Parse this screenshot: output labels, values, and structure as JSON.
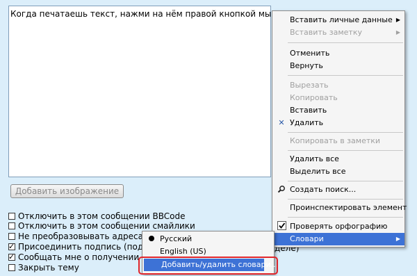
{
  "editor": {
    "text": "Когда печатаешь текст, нажми на нём правой кнопкой мыши."
  },
  "add_image_button": "Добавить изображение",
  "options": [
    {
      "label": "Отключить в этом сообщении BBCode",
      "checked": false
    },
    {
      "label": "Отключить в этом сообщении смайлики",
      "checked": false
    },
    {
      "label": "Не преобразовывать адреса U",
      "checked": false
    },
    {
      "label": "Присоединить подпись (подпи",
      "checked": true
    },
    {
      "label": "Сообщать мне о получении о",
      "checked": true
    },
    {
      "label": "Закрыть тему",
      "checked": false
    }
  ],
  "option_tail": {
    "text": "деле)"
  },
  "context_menu": {
    "items": [
      {
        "label": "Вставить личные данные",
        "disabled": false,
        "submenu": true
      },
      {
        "label": "Вставить заметку",
        "disabled": true,
        "submenu": true
      },
      {
        "label": "Отменить",
        "disabled": false
      },
      {
        "label": "Вернуть",
        "disabled": false
      },
      {
        "label": "Вырезать",
        "disabled": true
      },
      {
        "label": "Копировать",
        "disabled": true
      },
      {
        "label": "Вставить",
        "disabled": false
      },
      {
        "label": "Удалить",
        "disabled": false,
        "icon": "delete-x-icon"
      },
      {
        "label": "Копировать в заметки",
        "disabled": true
      },
      {
        "label": "Удалить все",
        "disabled": false
      },
      {
        "label": "Выделить все",
        "disabled": false
      },
      {
        "label": "Создать поиск...",
        "disabled": false,
        "icon": "search-icon"
      },
      {
        "label": "Проинспектировать элемент",
        "disabled": false
      },
      {
        "label": "Проверять орфографию",
        "disabled": false,
        "checked": true
      },
      {
        "label": "Словари",
        "disabled": false,
        "submenu": true,
        "highlighted": true
      }
    ]
  },
  "dictionaries_submenu": {
    "items": [
      {
        "label": "Русский",
        "selected": true
      },
      {
        "label": "English (US)",
        "selected": false
      },
      {
        "label": "Добавить/удалить словари...",
        "highlighted": true
      }
    ]
  },
  "colors": {
    "background": "#dbeefa",
    "highlight": "#3d72d6",
    "annotation_box": "#e0242a"
  }
}
